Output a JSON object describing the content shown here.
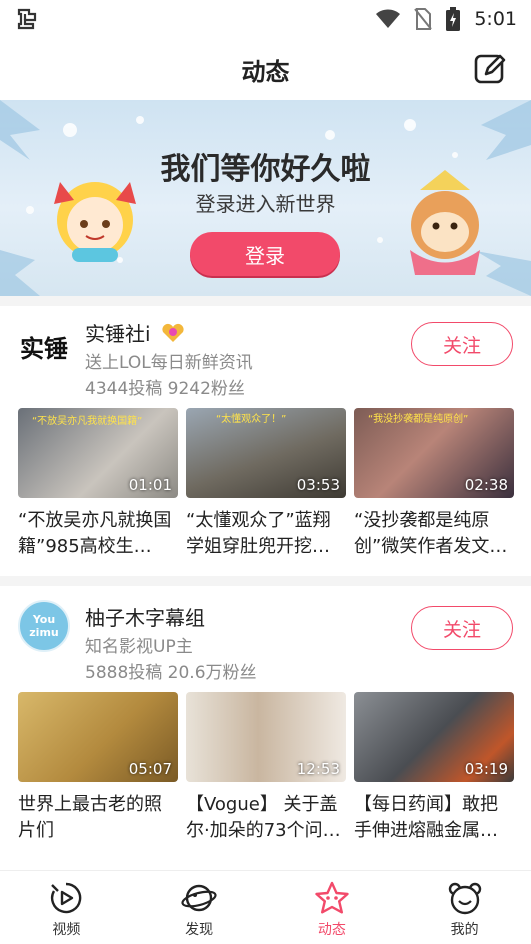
{
  "status_bar": {
    "left_icon": "bug-icon",
    "time": "5:01"
  },
  "header": {
    "title": "动态",
    "edit_icon": "edit-icon"
  },
  "banner": {
    "headline": "我们等你好久啦",
    "subline": "登录进入新世界",
    "login_label": "登录"
  },
  "uploaders": [
    {
      "name": "实锤社i",
      "badge": "heart-badge",
      "desc": "送上LOL每日新鲜资讯",
      "stats": "4344投稿  9242粉丝",
      "follow_label": "关注",
      "avatar_text": "实锤",
      "videos": [
        {
          "title": "“不放吴亦凡就换国籍”985高校生…",
          "duration": "01:01",
          "overlay": "“不放吴亦凡我就换国籍”"
        },
        {
          "title": "“太懂观众了”蓝翔学姐穿肚兜开挖…",
          "duration": "03:53",
          "overlay": "“太懂观众了！”"
        },
        {
          "title": "“没抄袭都是纯原创”微笑作者发文…",
          "duration": "02:38",
          "overlay": "“我没抄袭都是纯原创”"
        }
      ]
    },
    {
      "name": "柚子木字幕组",
      "desc": "知名影视UP主",
      "stats": "5888投稿  20.6万粉丝",
      "follow_label": "关注",
      "avatar_text": "You zimu",
      "videos": [
        {
          "title": "世界上最古老的照片们",
          "duration": "05:07"
        },
        {
          "title": "【Vogue】 关于盖尔·加朵的73个问…",
          "duration": "12:53"
        },
        {
          "title": "【每日药闻】敢把手伸进熔融金属…",
          "duration": "03:19"
        }
      ]
    }
  ],
  "tabs": [
    {
      "label": "视频",
      "icon": "video-icon"
    },
    {
      "label": "发现",
      "icon": "planet-icon"
    },
    {
      "label": "动态",
      "icon": "star-icon",
      "active": true
    },
    {
      "label": "我的",
      "icon": "bear-icon"
    }
  ],
  "colors": {
    "accent": "#f24a6a",
    "text": "#222222",
    "secondary": "#8a8a8a"
  }
}
